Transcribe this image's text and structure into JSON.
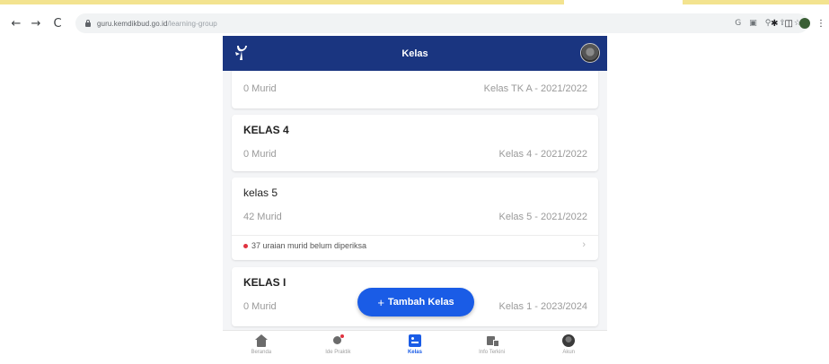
{
  "browser": {
    "url_host": "guru.kemdikbud.go.id",
    "url_path": "/learning-group",
    "nav": {
      "back": "←",
      "forward": "→",
      "reload": "C"
    }
  },
  "app": {
    "header_title": "Kelas",
    "classes": [
      {
        "name": "",
        "murid": "0 Murid",
        "kelas": "Kelas TK A - 2021/2022",
        "warning": ""
      },
      {
        "name": "KELAS 4",
        "murid": "0 Murid",
        "kelas": "Kelas 4 - 2021/2022",
        "warning": ""
      },
      {
        "name": "kelas 5",
        "murid": "42 Murid",
        "kelas": "Kelas 5 - 2021/2022",
        "warning": "37 uraian murid belum diperiksa"
      },
      {
        "name": "KELAS I",
        "murid": "0 Murid",
        "kelas": "Kelas 1 - 2023/2024",
        "warning": ""
      }
    ],
    "fab_label": "Tambah Kelas",
    "bottom_nav": [
      {
        "label": "Beranda",
        "icon": "home-icon"
      },
      {
        "label": "Ide Praktik",
        "icon": "idea-icon"
      },
      {
        "label": "Kelas",
        "icon": "class-icon",
        "active": true
      },
      {
        "label": "Info Terkini",
        "icon": "news-icon"
      },
      {
        "label": "Akun",
        "icon": "account-icon"
      }
    ]
  },
  "colors": {
    "header_bg": "#1a3580",
    "fab_bg": "#1a5ce6",
    "warning_dot": "#e0323f"
  }
}
